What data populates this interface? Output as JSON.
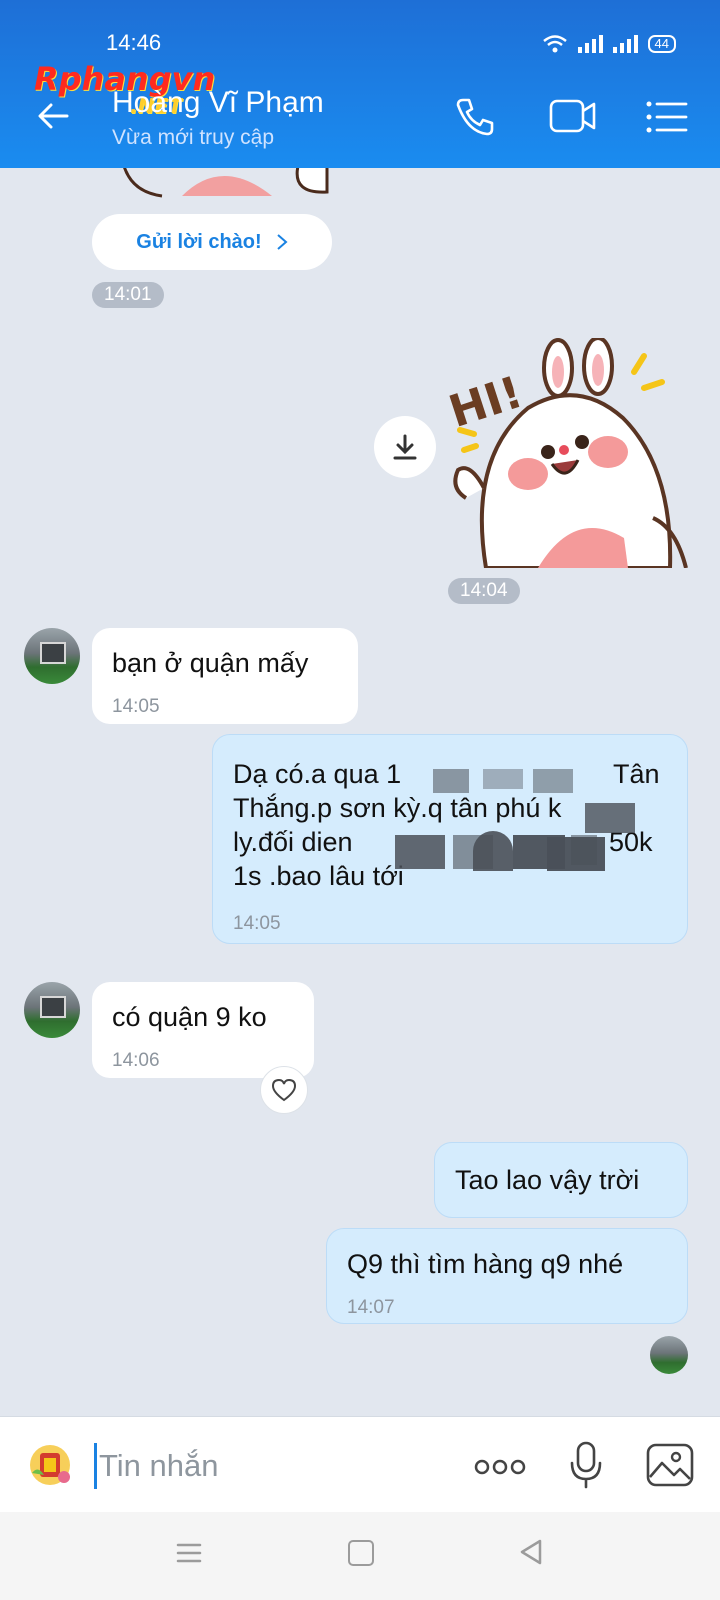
{
  "status_bar": {
    "time": "14:46",
    "battery": "44"
  },
  "watermark": {
    "text": "Rphangvn",
    "suffix": ".NET"
  },
  "header": {
    "contact_name": "Hoàng Vĩ  Phạm",
    "contact_status": "Vừa mới truy cập"
  },
  "chat": {
    "greeting_button": "Gửi lời chào!",
    "messages": [
      {
        "time_pill": "14:01"
      },
      {
        "time_pill": "14:04"
      },
      {
        "direction": "in",
        "lines": [
          "bạn ở quận mấy"
        ],
        "time": "14:05"
      },
      {
        "direction": "out",
        "lines": [
          "Dạ có.a qua 1",
          "Thắng.p sơn kỳ.q tân phú k",
          "ly.đối dien",
          "1s .bao lâu tới"
        ],
        "time": "14:05",
        "fragments": [
          "Tân",
          "50k"
        ]
      },
      {
        "direction": "in",
        "lines": [
          "có quận 9 ko"
        ],
        "time": "14:06"
      },
      {
        "direction": "out",
        "lines": [
          "Tao lao vậy trời"
        ]
      },
      {
        "direction": "out",
        "lines": [
          "Q9 thì tìm hàng q9 nhé"
        ],
        "time": "14:07"
      }
    ],
    "sticker_text": "HI!"
  },
  "composer": {
    "placeholder": "Tin nhắn"
  },
  "colors": {
    "header": "#1a8cf0",
    "outgoing_bubble": "#d5ecfd",
    "chat_background": "#e2e7ef",
    "accent": "#1a82e2"
  }
}
